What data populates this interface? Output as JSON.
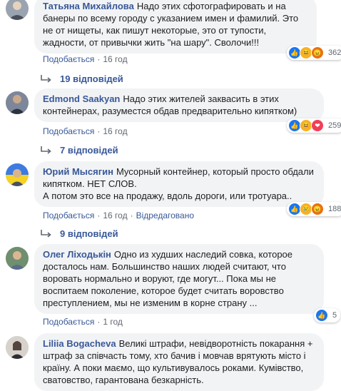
{
  "like_label": "Подобається",
  "edited_label": "Відредаговано",
  "comments": [
    {
      "author": "Татьяна Михайлова",
      "text": "Надо этих сфотографировать и на банеры по всему городу с указанием имен и фамилий. Это не от нищеты, как пишут некоторые, это от тупости, жадности, от привычки жить \"на шару\". Сволочи!!!",
      "time": "16 год",
      "reaction_count": "362",
      "reaction_icons": [
        "like-icon",
        "haha-icon",
        "angry-icon"
      ],
      "replies": "19 відповідей"
    },
    {
      "author": "Edmond Saakyan",
      "text": "Надо этих жителей заквасить в этих контейнерах, разуместся обдав предварительно кипятком)",
      "time": "16 год",
      "reaction_count": "259",
      "reaction_icons": [
        "like-icon",
        "haha-icon",
        "love-icon"
      ],
      "replies": "7 відповідей"
    },
    {
      "author": "Юрий Мысягин",
      "text": "Мусорный контейнер, который просто обдали кипятком. НЕТ СЛОВ.\nА потом это все на продажу, вдоль дороги, или тротуара..",
      "time": "16 год",
      "edited": true,
      "reaction_count": "188",
      "reaction_icons": [
        "like-icon",
        "sad-icon",
        "angry-icon"
      ],
      "replies": "9 відповідей"
    },
    {
      "author": "Олег Ліходькін",
      "text": "Одно из худших наследий совка, которое досталось нам. Большинство наших людей считают, что воровать нормально и воруют, где могут... Пока мы не воспитаем поколение, которое будет считать воровство преступлением, мы не изменим в корне страну ...",
      "time": "1 год",
      "reaction_count": "5",
      "reaction_icons": [
        "like-icon"
      ]
    },
    {
      "author": "Liliia Bogacheva",
      "text": "Великі штрафи, невідворотність покарання + штраф за співчасть тому, хто бачив і мовчав врятують місто і країну. А поки маємо, що культивувалось роками. Кумівство, сватовство, гарантована безкарність."
    }
  ]
}
